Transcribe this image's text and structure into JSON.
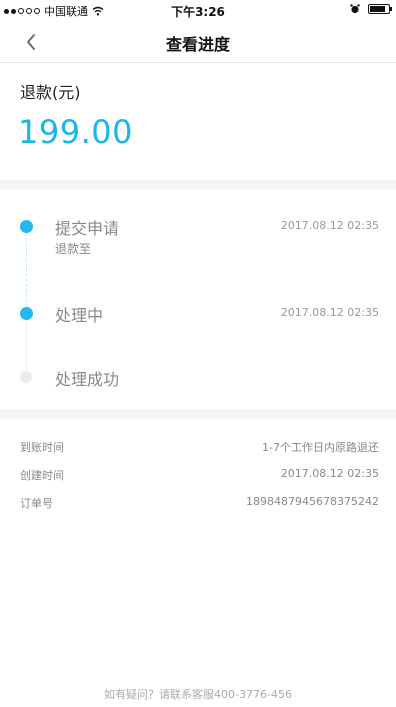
{
  "status_bar": {
    "carrier": "中国联通",
    "time": "下午3:26",
    "battery_level": 0.85
  },
  "nav": {
    "title": "查看进度"
  },
  "refund": {
    "label": "退款(元)",
    "amount": "199.00",
    "accent_color": "#19b6ea"
  },
  "progress": {
    "steps": [
      {
        "title": "提交申请",
        "subtitle": "退款至",
        "time": "2017.08.12 02:35",
        "status": "done"
      },
      {
        "title": "处理中",
        "time": "2017.08.12 02:35",
        "status": "current"
      },
      {
        "title": "处理成功",
        "status": "pending"
      }
    ]
  },
  "details": [
    {
      "label": "到账时间",
      "value": "1-7个工作日内原路退还"
    },
    {
      "label": "创建时间",
      "value": "2017.08.12 02:35"
    },
    {
      "label": "订单号",
      "value": "1898487945678375242"
    }
  ],
  "footer": {
    "text": "如有疑问？请联系客服400-3776-456"
  }
}
